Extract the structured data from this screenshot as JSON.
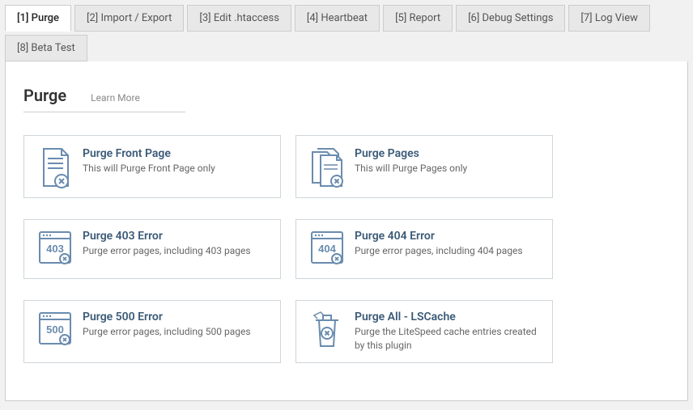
{
  "tabs": [
    {
      "label": "[1] Purge",
      "active": true
    },
    {
      "label": "[2] Import / Export"
    },
    {
      "label": "[3] Edit .htaccess"
    },
    {
      "label": "[4] Heartbeat"
    },
    {
      "label": "[5] Report"
    },
    {
      "label": "[6] Debug Settings"
    },
    {
      "label": "[7] Log View"
    },
    {
      "label": "[8] Beta Test"
    }
  ],
  "header": {
    "title": "Purge",
    "learn_more": "Learn More"
  },
  "cards": [
    {
      "title": "Purge Front Page",
      "desc": "This will Purge Front Page only",
      "icon": "doc-x"
    },
    {
      "title": "Purge Pages",
      "desc": "This will Purge Pages only",
      "icon": "docs-x"
    },
    {
      "title": "Purge 403 Error",
      "desc": "Purge error pages, including 403 pages",
      "icon": "num-403"
    },
    {
      "title": "Purge 404 Error",
      "desc": "Purge error pages, including 404 pages",
      "icon": "num-404"
    },
    {
      "title": "Purge 500 Error",
      "desc": "Purge error pages, including 500 pages",
      "icon": "num-500"
    },
    {
      "title": "Purge All - LSCache",
      "desc": "Purge the LiteSpeed cache entries created by this plugin",
      "icon": "trash-x"
    }
  ],
  "icon_colors": {
    "stroke": "#6a8caf",
    "fill": "none"
  }
}
